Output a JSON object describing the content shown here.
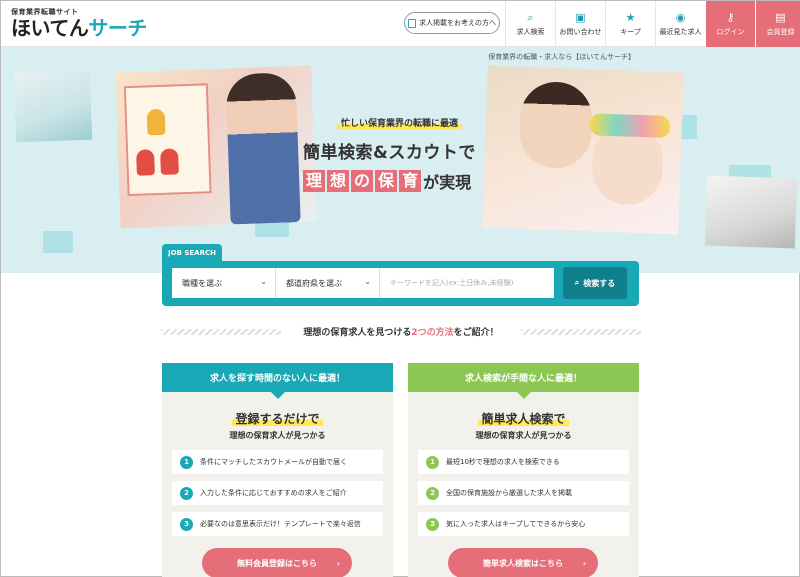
{
  "header": {
    "tagline": "保育業界転職サイト",
    "logo_main": "ほいてん",
    "logo_accent": "サーチ",
    "employer_btn": "求人掲載をお考えの方へ",
    "nav": [
      {
        "label": "求人検索",
        "icon": "search-icon"
      },
      {
        "label": "お問い合わせ",
        "icon": "chat-icon"
      },
      {
        "label": "キープ",
        "icon": "star-icon"
      },
      {
        "label": "最近見た求人",
        "icon": "eye-icon"
      },
      {
        "label": "ログイン",
        "icon": "key-icon"
      },
      {
        "label": "会員登録",
        "icon": "document-icon"
      }
    ]
  },
  "hero": {
    "breadcrumb": "保育業界の転職・求人なら【ほいてんサーチ】",
    "subtitle": "忙しい保育業界の転職に最適",
    "headline": "簡単検索&スカウトで",
    "chips": [
      "理",
      "想",
      "の",
      "保",
      "育"
    ],
    "tail": "が実現"
  },
  "search": {
    "tab": "JOB SEARCH",
    "job_type": "職種を選ぶ",
    "prefecture": "都道府県を選ぶ",
    "keyword_placeholder": "キーワードを記入(ex:土日休み,未経験)",
    "button": "検索する"
  },
  "intro": {
    "before": "理想の保育求人を見つける",
    "highlight": "2つの方法",
    "after": "をご紹介！"
  },
  "cards": [
    {
      "header": "求人を探す時間のない人に最適！",
      "title": "登録するだけで",
      "subtitle": "理想の保育求人が見つかる",
      "items": [
        {
          "num": "1",
          "text": "条件にマッチしたスカウトメールが自動で届く"
        },
        {
          "num": "2",
          "text": "入力した条件に応じておすすめの求人をご紹介"
        },
        {
          "num": "3",
          "text": "必要なのは意思表示だけ！テンプレートで楽々返信"
        }
      ],
      "cta": "無料会員登録はこちら"
    },
    {
      "header": "求人検索が手間な人に最適！",
      "title": "簡単求人検索で",
      "subtitle": "理想の保育求人が見つかる",
      "items": [
        {
          "num": "1",
          "text": "最短10秒で理想の求人を検索できる"
        },
        {
          "num": "2",
          "text": "全国の保育施設から厳選した求人を掲載"
        },
        {
          "num": "3",
          "text": "気に入った求人はキープしてできるから安心"
        }
      ],
      "cta": "簡単求人検索はこちら"
    }
  ],
  "colors": {
    "brand_teal": "#19a8b5",
    "accent_pink": "#e56e78",
    "accent_green": "#8cc653",
    "highlight_yellow": "#ffe95a"
  }
}
